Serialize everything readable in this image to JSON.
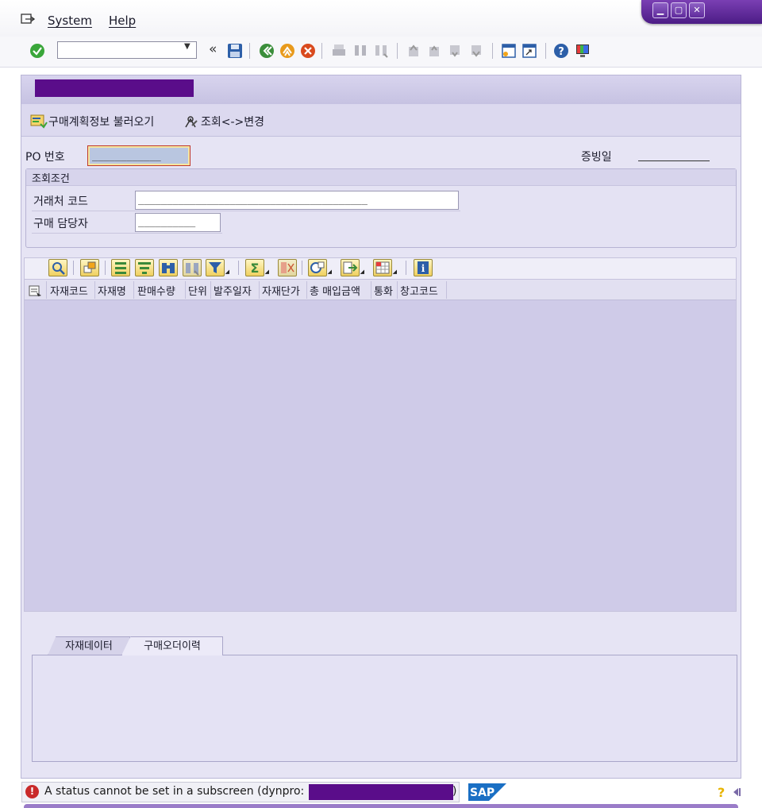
{
  "menu": {
    "system": "System",
    "help": "Help"
  },
  "toolbar": {
    "back_chevron": "«"
  },
  "app_toolbar": {
    "load_plan": "구매계획정보 불러오기",
    "toggle_display_change": "조회<->변경"
  },
  "header": {
    "po_label": "PO 번호",
    "po_value": "____________",
    "doc_date_label": "증빙일"
  },
  "conditions": {
    "title": "조회조건",
    "vendor_label": "거래처 코드",
    "vendor_value": "________________________________________",
    "buyer_label": "구매 담당자",
    "buyer_value": "__________"
  },
  "grid": {
    "columns": [
      "자재코드",
      "자재명",
      "판매수량",
      "단위",
      "발주일자",
      "자재단가",
      "총 매입금액",
      "통화",
      "창고코드"
    ]
  },
  "tabs": [
    {
      "label": "자재데이터"
    },
    {
      "label": "구매오더이력"
    }
  ],
  "status": {
    "message": "A status cannot be set in a subscreen (dynpro:"
  },
  "brand": {
    "logo_text": "SAP"
  },
  "colors": {
    "accent": "#5a0d8a",
    "grid_body": "#cfcbe8",
    "error": "#c92a2a"
  }
}
